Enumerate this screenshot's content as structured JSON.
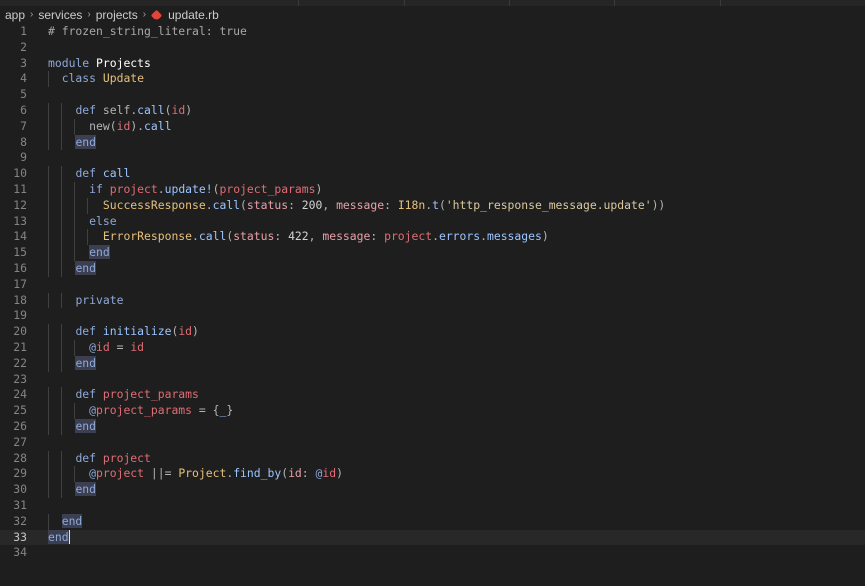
{
  "breadcrumb": {
    "items": [
      "app",
      "services",
      "projects",
      "update.rb"
    ],
    "file_icon": "ruby-gem-icon"
  },
  "editor": {
    "current_line": 33,
    "line_numbers": [
      "1",
      "2",
      "3",
      "4",
      "5",
      "6",
      "7",
      "8",
      "9",
      "10",
      "11",
      "12",
      "13",
      "14",
      "15",
      "16",
      "17",
      "18",
      "19",
      "20",
      "21",
      "22",
      "23",
      "24",
      "25",
      "26",
      "27",
      "28",
      "29",
      "30",
      "31",
      "32",
      "33",
      "34"
    ],
    "lines": [
      "# frozen_string_literal: true",
      "",
      "module Projects",
      "  class Update",
      "",
      "    def self.call(id)",
      "      new(id).call",
      "    end",
      "",
      "    def call",
      "      if project.update!(project_params)",
      "        SuccessResponse.call(status: 200, message: I18n.t('http_response_message.update'))",
      "      else",
      "        ErrorResponse.call(status: 422, message: project.errors.messages)",
      "      end",
      "    end",
      "",
      "    private",
      "",
      "    def initialize(id)",
      "      @id = id",
      "    end",
      "",
      "    def project_params",
      "      @project_params = {_}",
      "    end",
      "",
      "    def project",
      "      @project ||= Project.find_by(id: @id)",
      "    end",
      "",
      "  end",
      "end",
      ""
    ]
  },
  "colors": {
    "background": "#1e1e1e",
    "keyword": "#8da9d8",
    "type": "#e5c07b",
    "method": "#9cc4ff",
    "param": "#e06c75",
    "string": "#d9c9a0",
    "end_highlight": "#3b3f51"
  }
}
